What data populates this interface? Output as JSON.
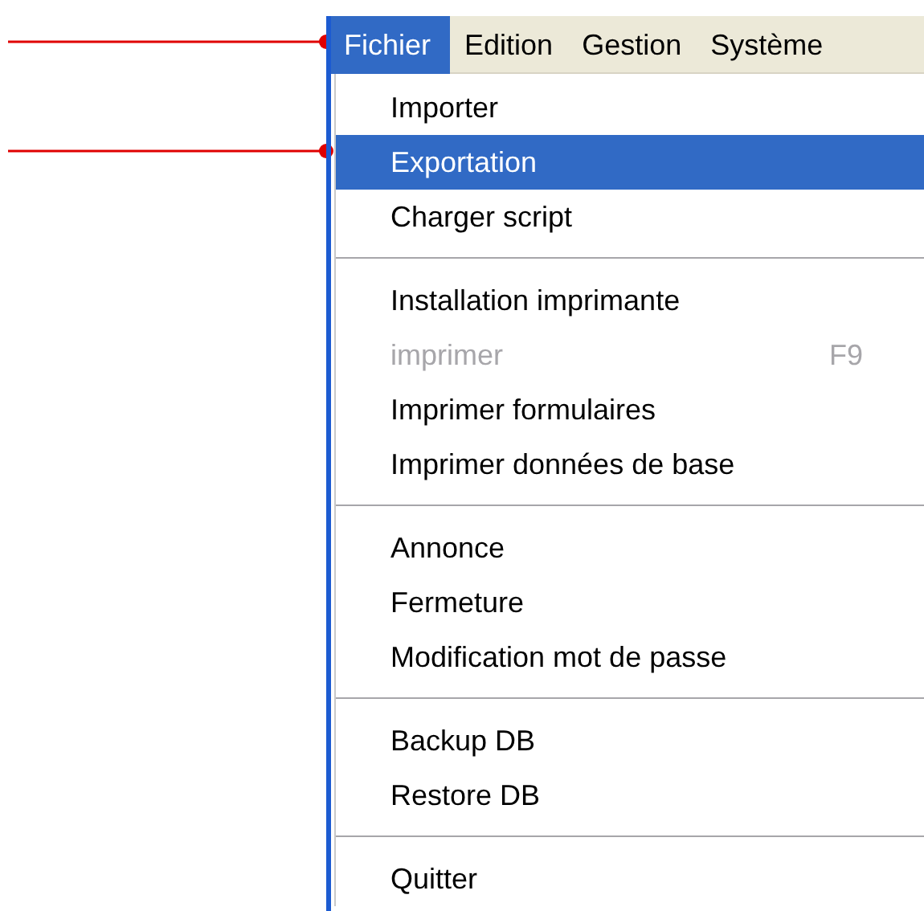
{
  "menubar": [
    {
      "label": "Fichier",
      "selected": true
    },
    {
      "label": "Edition",
      "selected": false
    },
    {
      "label": "Gestion",
      "selected": false
    },
    {
      "label": "Système",
      "selected": false
    }
  ],
  "menu": {
    "items": [
      {
        "kind": "item",
        "label": "Importer",
        "selected": false,
        "disabled": false
      },
      {
        "kind": "item",
        "label": "Exportation",
        "selected": true,
        "disabled": false
      },
      {
        "kind": "item",
        "label": "Charger script",
        "selected": false,
        "disabled": false
      },
      {
        "kind": "separator"
      },
      {
        "kind": "item",
        "label": "Installation imprimante",
        "selected": false,
        "disabled": false
      },
      {
        "kind": "item",
        "label": "imprimer",
        "shortcut": "F9",
        "selected": false,
        "disabled": true
      },
      {
        "kind": "item",
        "label": "Imprimer formulaires",
        "selected": false,
        "disabled": false
      },
      {
        "kind": "item",
        "label": "Imprimer données de base",
        "selected": false,
        "disabled": false
      },
      {
        "kind": "separator"
      },
      {
        "kind": "item",
        "label": "Annonce",
        "selected": false,
        "disabled": false
      },
      {
        "kind": "item",
        "label": "Fermeture",
        "selected": false,
        "disabled": false
      },
      {
        "kind": "item",
        "label": "Modification mot de passe",
        "selected": false,
        "disabled": false
      },
      {
        "kind": "separator"
      },
      {
        "kind": "item",
        "label": "Backup DB",
        "selected": false,
        "disabled": false
      },
      {
        "kind": "item",
        "label": "Restore DB",
        "selected": false,
        "disabled": false
      },
      {
        "kind": "separator"
      },
      {
        "kind": "item",
        "label": "Quitter",
        "selected": false,
        "disabled": false
      }
    ]
  }
}
